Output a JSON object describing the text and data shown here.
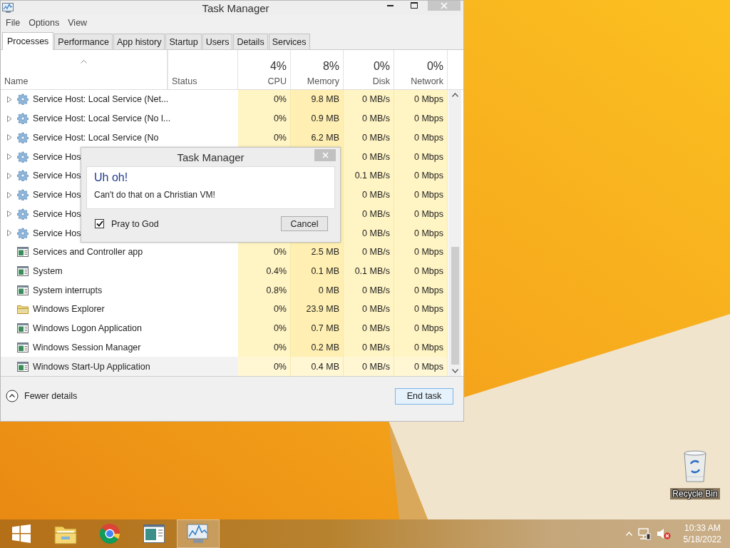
{
  "window": {
    "title": "Task Manager"
  },
  "menu": [
    "File",
    "Options",
    "View"
  ],
  "tabs": [
    {
      "label": "Processes",
      "selected": true
    },
    {
      "label": "Performance",
      "selected": false
    },
    {
      "label": "App history",
      "selected": false
    },
    {
      "label": "Startup",
      "selected": false
    },
    {
      "label": "Users",
      "selected": false
    },
    {
      "label": "Details",
      "selected": false
    },
    {
      "label": "Services",
      "selected": false
    }
  ],
  "columns": [
    {
      "label": "Name"
    },
    {
      "label": "Status"
    },
    {
      "label": "CPU",
      "usage": "4%"
    },
    {
      "label": "Memory",
      "usage": "8%"
    },
    {
      "label": "Disk",
      "usage": "0%"
    },
    {
      "label": "Network",
      "usage": "0%"
    }
  ],
  "rows": [
    {
      "name": "Service Host: Local Service (Net...",
      "kind": "group",
      "selected": false,
      "cpu": "0%",
      "memory": "9.8 MB",
      "disk": "0 MB/s",
      "network": "0 Mbps"
    },
    {
      "name": "Service Host: Local Service (No l...",
      "kind": "group",
      "selected": false,
      "cpu": "0%",
      "memory": "0.9 MB",
      "disk": "0 MB/s",
      "network": "0 Mbps"
    },
    {
      "name": "Service Host: Local Service (No",
      "kind": "group",
      "selected": false,
      "cpu": "0%",
      "memory": "6.2 MB",
      "disk": "0 MB/s",
      "network": "0 Mbps"
    },
    {
      "name": "Service Hos",
      "kind": "group",
      "selected": false,
      "disk": "0 MB/s",
      "network": "0 Mbps"
    },
    {
      "name": "Service Hos",
      "kind": "group",
      "selected": false,
      "disk": "0.1 MB/s",
      "network": "0 Mbps"
    },
    {
      "name": "Service Hos",
      "kind": "group",
      "selected": false,
      "disk": "0 MB/s",
      "network": "0 Mbps"
    },
    {
      "name": "Service Hos",
      "kind": "group",
      "selected": false,
      "disk": "0 MB/s",
      "network": "0 Mbps"
    },
    {
      "name": "Service Hos",
      "kind": "group",
      "selected": false,
      "disk": "0 MB/s",
      "network": "0 Mbps"
    },
    {
      "name": "Services and Controller app",
      "kind": "process",
      "selected": false,
      "cpu": "0%",
      "memory": "2.5 MB",
      "disk": "0 MB/s",
      "network": "0 Mbps"
    },
    {
      "name": "System",
      "kind": "process",
      "selected": false,
      "cpu": "0.4%",
      "memory": "0.1 MB",
      "disk": "0.1 MB/s",
      "network": "0 Mbps"
    },
    {
      "name": "System interrupts",
      "kind": "process",
      "selected": false,
      "cpu": "0.8%",
      "memory": "0 MB",
      "disk": "0 MB/s",
      "network": "0 Mbps"
    },
    {
      "name": "Windows Explorer",
      "kind": "explorer",
      "selected": false,
      "cpu": "0%",
      "memory": "23.9 MB",
      "disk": "0 MB/s",
      "network": "0 Mbps"
    },
    {
      "name": "Windows Logon Application",
      "kind": "process",
      "selected": false,
      "cpu": "0%",
      "memory": "0.7 MB",
      "disk": "0 MB/s",
      "network": "0 Mbps"
    },
    {
      "name": "Windows Session Manager",
      "kind": "process",
      "selected": false,
      "cpu": "0%",
      "memory": "0.2 MB",
      "disk": "0 MB/s",
      "network": "0 Mbps"
    },
    {
      "name": "Windows Start-Up Application",
      "kind": "process",
      "selected": true,
      "cpu": "0%",
      "memory": "0.4 MB",
      "disk": "0 MB/s",
      "network": "0 Mbps"
    }
  ],
  "footer": {
    "details_toggle": "Fewer details",
    "end_task": "End task"
  },
  "dialog": {
    "title": "Task Manager",
    "heading": "Uh oh!",
    "message": "Can't do that on a Christian VM!",
    "checkbox": {
      "label": "Pray to God",
      "checked": true
    },
    "buttons": [
      "Cancel"
    ]
  },
  "desktop": {
    "icons": [
      {
        "label": "Recycle Bin"
      }
    ]
  },
  "taskbar": {
    "apps": [
      {
        "kind": "start",
        "selected": false
      },
      {
        "kind": "explorer",
        "selected": false
      },
      {
        "kind": "browser",
        "selected": false
      },
      {
        "kind": "document",
        "selected": false
      },
      {
        "kind": "taskmanager",
        "selected": true
      }
    ],
    "time": "10:33 AM",
    "date": "5/18/2022"
  }
}
